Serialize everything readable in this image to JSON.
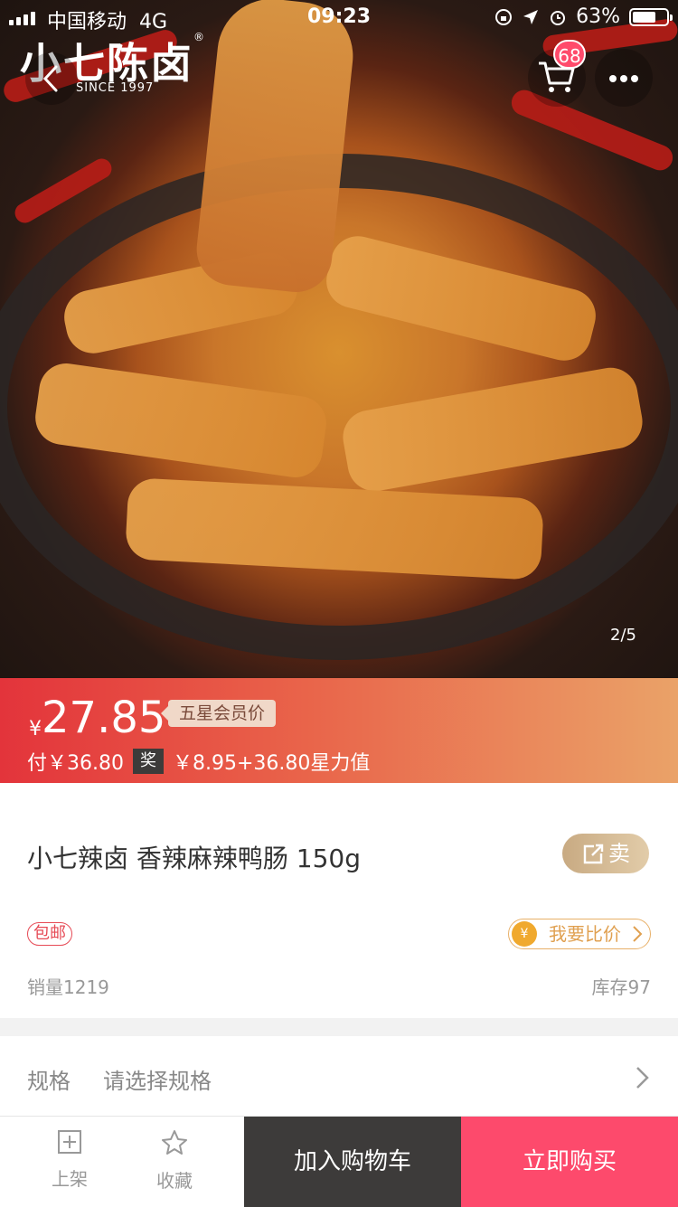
{
  "status_bar": {
    "carrier": "中国移动",
    "network": "4G",
    "time": "09:23",
    "battery_text": "63%",
    "battery_level": 0.63
  },
  "brand": {
    "name": "小七陈卤",
    "registered": "®",
    "since": "SINCE 1997"
  },
  "header": {
    "cart_count": "68"
  },
  "gallery": {
    "pager": "2/5"
  },
  "price": {
    "currency": "¥",
    "member_price": "27.85",
    "member_tag": "五星会员价",
    "pay_text": "付￥36.80",
    "reward_label": "奖",
    "reward_text": "￥8.95+36.80星力值"
  },
  "product": {
    "title": "小七辣卤 香辣麻辣鸭肠 150g",
    "sell_label": "卖",
    "shipping_tag": "包邮",
    "compare_coin": "¥",
    "compare_label": "我要比价",
    "sales": "销量1219",
    "stock": "库存97"
  },
  "spec": {
    "label": "规格",
    "value": "请选择规格"
  },
  "bottom_bar": {
    "shelf_label": "上架",
    "favorite_label": "收藏",
    "add_to_cart": "加入购物车",
    "buy_now": "立即购买"
  },
  "colors": {
    "accent_pink": "#fd4a6c",
    "dark_button": "#3d3b3a",
    "price_gradient_start": "#e3343b",
    "price_gradient_end": "#eaa268",
    "gold": "#c8aa82"
  }
}
